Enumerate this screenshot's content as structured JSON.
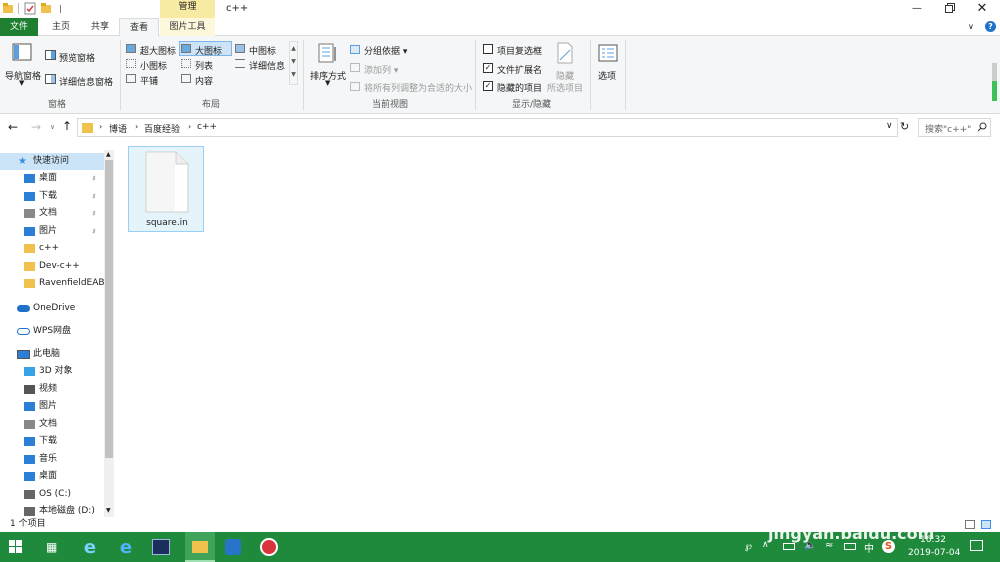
{
  "title": {
    "path": "c++",
    "context_tab": "管理"
  },
  "tabs": {
    "file": "文件",
    "home": "主页",
    "share": "共享",
    "view": "查看",
    "picture_tools": "图片工具"
  },
  "ribbon": {
    "panes": {
      "nav_pane": "导航窗格",
      "preview_pane": "预览窗格",
      "details_pane": "详细信息窗格",
      "group": "窗格"
    },
    "layout": {
      "xl_icons": "超大图标",
      "large_icons": "大图标",
      "medium_icons": "中图标",
      "small_icons": "小图标",
      "list": "列表",
      "details": "详细信息",
      "tiles": "平铺",
      "content": "内容",
      "group": "布局"
    },
    "current_view": {
      "sort_by": "排序方式",
      "group_by": "分组依据",
      "add_column": "添加列",
      "fit_columns": "将所有列调整为合适的大小",
      "group": "当前视图"
    },
    "show_hide": {
      "item_checkboxes": "项目复选框",
      "file_ext": "文件扩展名",
      "hidden_items": "隐藏的项目",
      "hide": "隐藏",
      "selected": "所选项目",
      "group": "显示/隐藏",
      "item_checkboxes_checked": false,
      "file_ext_checked": true,
      "hidden_items_checked": true
    },
    "options": "选项"
  },
  "address": {
    "crumbs": [
      "博语",
      "百度经验",
      "c++"
    ],
    "search_placeholder": "搜索\"c++\""
  },
  "nav": {
    "quick_access": "快速访问",
    "quick_items": [
      {
        "label": "桌面",
        "icon": "desktop-icon",
        "pinned": true
      },
      {
        "label": "下载",
        "icon": "download-icon",
        "pinned": true
      },
      {
        "label": "文档",
        "icon": "document-icon",
        "pinned": true
      },
      {
        "label": "图片",
        "icon": "picture-icon",
        "pinned": true
      },
      {
        "label": "c++",
        "icon": "folder-icon",
        "pinned": false
      },
      {
        "label": "Dev-c++",
        "icon": "folder-icon",
        "pinned": false
      },
      {
        "label": "RavenfieldEABu",
        "icon": "folder-icon",
        "pinned": false
      }
    ],
    "onedrive": "OneDrive",
    "wps": "WPS网盘",
    "this_pc": "此电脑",
    "pc_items": [
      {
        "label": "3D 对象",
        "icon": "3d-objects-icon"
      },
      {
        "label": "视频",
        "icon": "video-icon"
      },
      {
        "label": "图片",
        "icon": "picture-icon"
      },
      {
        "label": "文档",
        "icon": "document-icon"
      },
      {
        "label": "下载",
        "icon": "download-icon"
      },
      {
        "label": "音乐",
        "icon": "music-icon"
      },
      {
        "label": "桌面",
        "icon": "desktop-icon"
      },
      {
        "label": "OS (C:)",
        "icon": "drive-icon"
      },
      {
        "label": "本地磁盘 (D:)",
        "icon": "drive-icon"
      }
    ]
  },
  "files": [
    {
      "name": "square.in",
      "icon": "file-icon"
    }
  ],
  "status": {
    "count": "1 个项目"
  },
  "taskbar": {
    "time": "16:32",
    "date": "2019-07-04",
    "ime": "中",
    "watermark": "jingyan.baidu.com",
    "colors": {
      "taskbar": "#1f8a3b",
      "accent": "#0078d7"
    }
  }
}
